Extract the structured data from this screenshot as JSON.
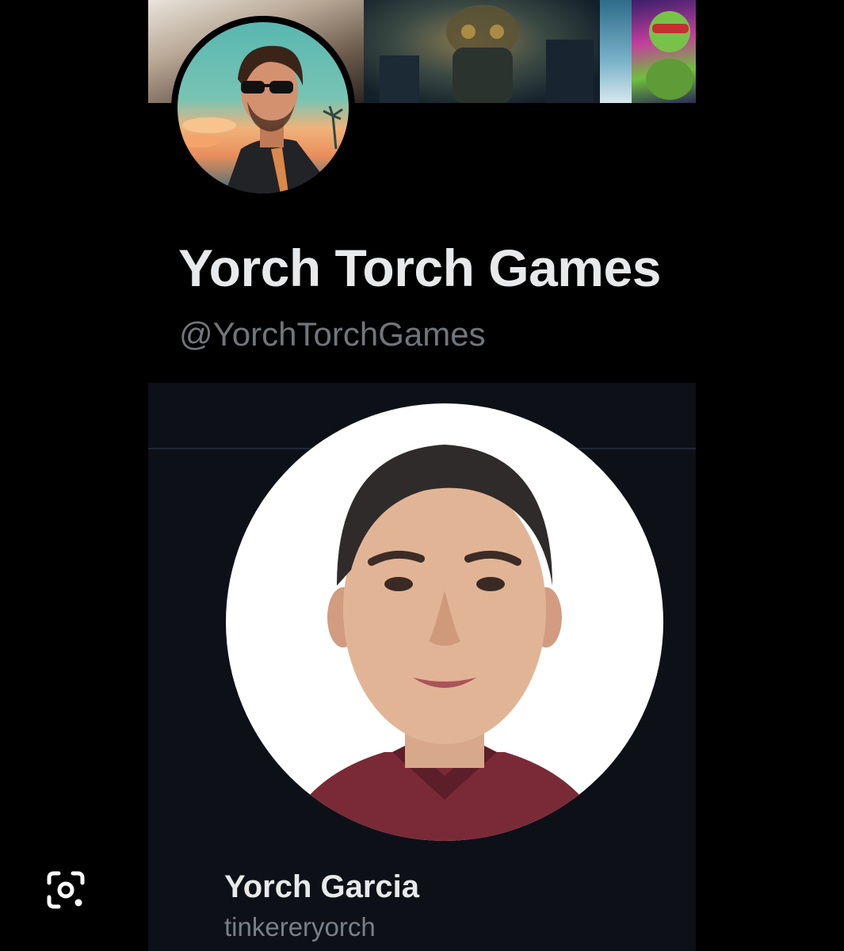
{
  "profile": {
    "display_name": "Yorch Torch Games",
    "handle": "@YorchTorchGames"
  },
  "linked_profile": {
    "name": "Yorch Garcia",
    "username": "tinkereryorch"
  },
  "icons": {
    "lens": "image-search-lens-icon"
  },
  "colors": {
    "background": "#000000",
    "panel": "#0e1018",
    "name_text": "#e7e9ea",
    "handle_text": "#71767b"
  }
}
